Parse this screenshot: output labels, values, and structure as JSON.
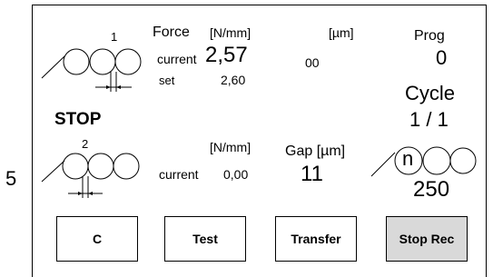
{
  "side_number": "5",
  "roll1": {
    "number": "1",
    "force_label": "Force",
    "force_unit": "[N/mm]",
    "current_label": "current",
    "current_value": "2,57",
    "set_label": "set",
    "set_value": "2,60"
  },
  "micron": {
    "unit": "[µm]",
    "value": "00"
  },
  "prog": {
    "label": "Prog",
    "value": "0"
  },
  "cycle": {
    "label": "Cycle",
    "value": "1 / 1"
  },
  "status": "STOP",
  "roll2": {
    "number": "2",
    "force_unit": "[N/mm]",
    "current_label": "current",
    "current_value": "0,00"
  },
  "gap": {
    "label": "Gap [µm]",
    "value": "11"
  },
  "counter": {
    "n_label": "n",
    "value": "250"
  },
  "buttons": [
    {
      "label": "C",
      "active": false
    },
    {
      "label": "Test",
      "active": false
    },
    {
      "label": "Transfer",
      "active": false
    },
    {
      "label": "Stop Rec",
      "active": true
    }
  ]
}
